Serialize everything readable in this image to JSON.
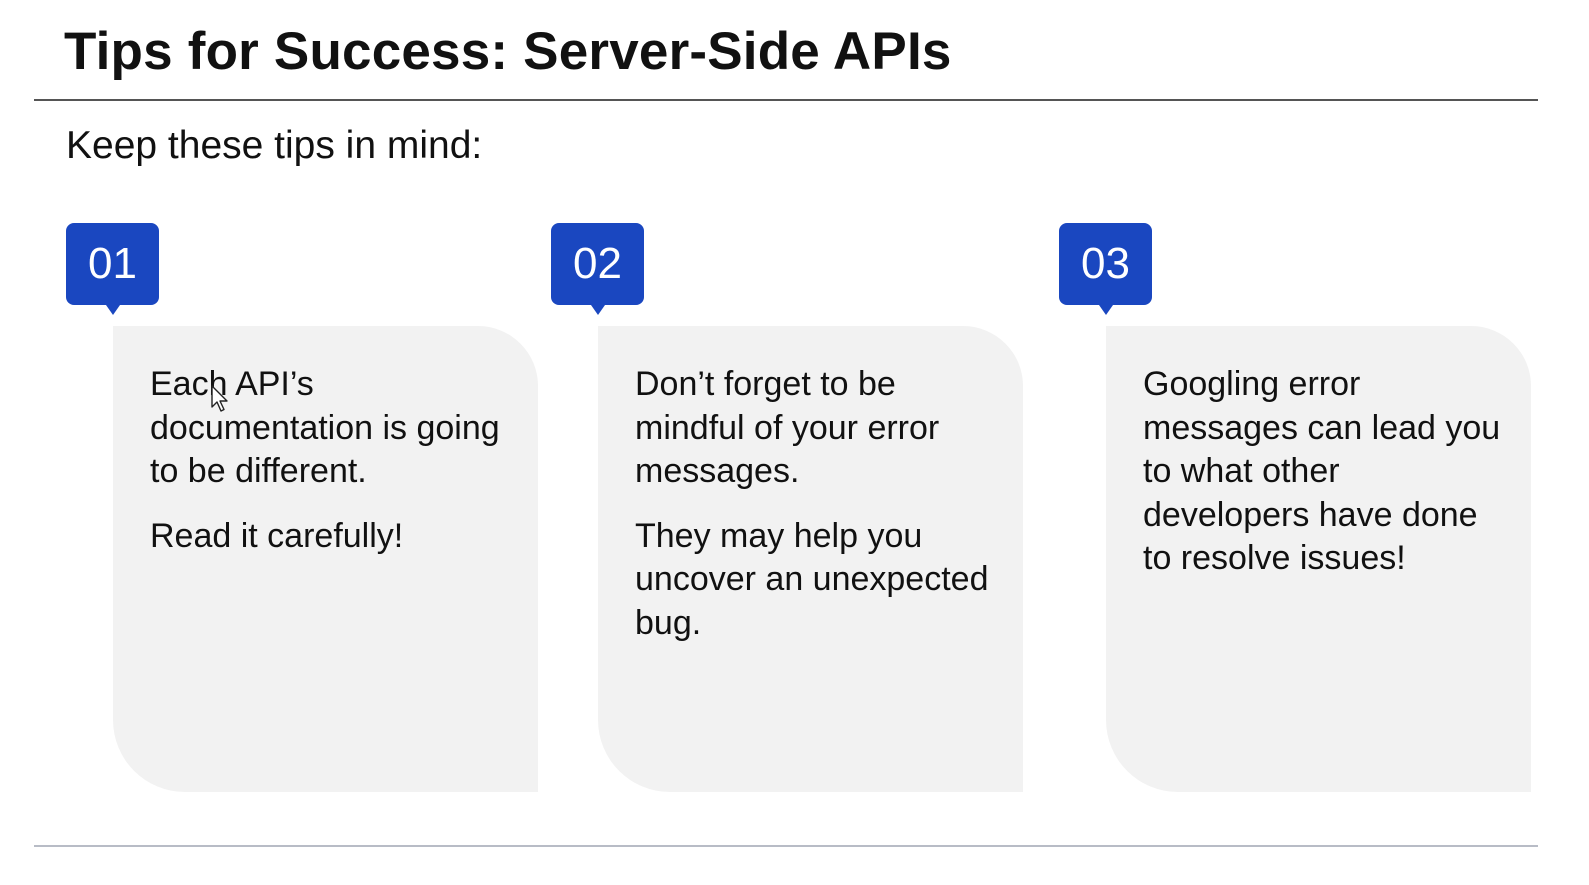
{
  "slide": {
    "title": "Tips for Success: Server-Side APIs",
    "subtitle": "Keep these tips in mind:"
  },
  "tips": [
    {
      "number": "01",
      "paragraphs": [
        "Each API’s documentation is going to be different.",
        "Read it carefully!"
      ]
    },
    {
      "number": "02",
      "paragraphs": [
        "Don’t forget to be mindful of your error messages.",
        "They may help you uncover an unexpected bug."
      ]
    },
    {
      "number": "03",
      "paragraphs": [
        "Googling error messages can lead you to what other developers have done to resolve issues!"
      ]
    }
  ],
  "colors": {
    "badge": "#1a47c0",
    "card": "#f2f2f2",
    "text": "#111111"
  },
  "icons": {
    "cursor": "mouse-pointer-icon"
  }
}
